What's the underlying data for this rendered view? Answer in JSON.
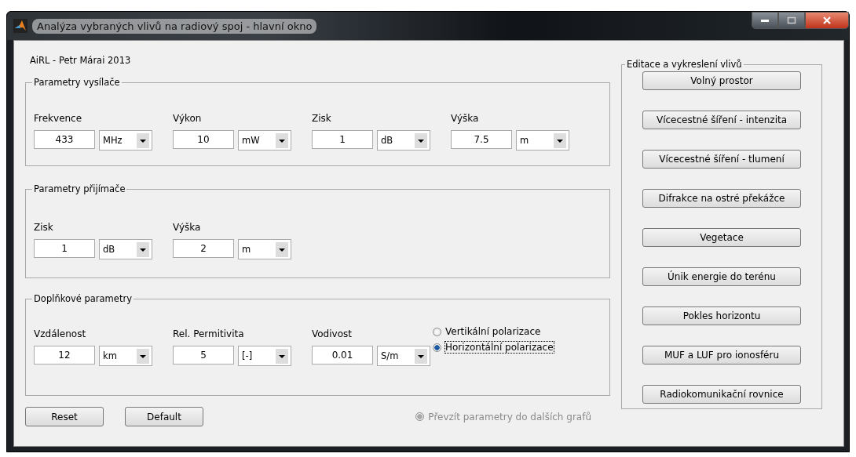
{
  "window": {
    "title": "Analýza vybraných vlivů na radiový spoj - hlavní okno"
  },
  "author": "AiRL - Petr Márai 2013",
  "groups": [
    {
      "title": "Parametry vysílače",
      "fields": [
        {
          "label": "Frekvence",
          "value": "433",
          "unit": "MHz"
        },
        {
          "label": "Výkon",
          "value": "10",
          "unit": "mW"
        },
        {
          "label": "Zisk",
          "value": "1",
          "unit": "dB"
        },
        {
          "label": "Výška",
          "value": "7.5",
          "unit": "m"
        }
      ]
    },
    {
      "title": "Parametry přijímače",
      "fields": [
        {
          "label": "Zisk",
          "value": "1",
          "unit": "dB"
        },
        {
          "label": "Výška",
          "value": "2",
          "unit": "m"
        }
      ]
    },
    {
      "title": "Doplňkové parametry",
      "fields": [
        {
          "label": "Vzdálenost",
          "value": "12",
          "unit": "km"
        },
        {
          "label": "Rel. Permitivita",
          "value": "5",
          "unit": "[-]"
        },
        {
          "label": "Vodivost",
          "value": "0.01",
          "unit": "S/m"
        }
      ],
      "polarization": [
        {
          "label": "Vertikální polarizace",
          "selected": false,
          "focused": false
        },
        {
          "label": "Horizontální polarizace",
          "selected": true,
          "focused": true
        }
      ]
    }
  ],
  "bottom_buttons": [
    "Reset",
    "Default"
  ],
  "transfer_option": {
    "label": "Převzít parametry do dalších grafů",
    "selected": true,
    "disabled": true
  },
  "effects_panel": {
    "title": "Editace a vykreslení vlivů",
    "buttons": [
      "Volný prostor",
      "Vícecestné šíření - intenzita",
      "Vícecestné šíření - tlumení",
      "Difrakce na ostré překážce",
      "Vegetace",
      "Únik energie do terénu",
      "Pokles horizontu",
      "MUF a LUF pro ionosféru",
      "Radiokomunikační rovnice"
    ]
  }
}
